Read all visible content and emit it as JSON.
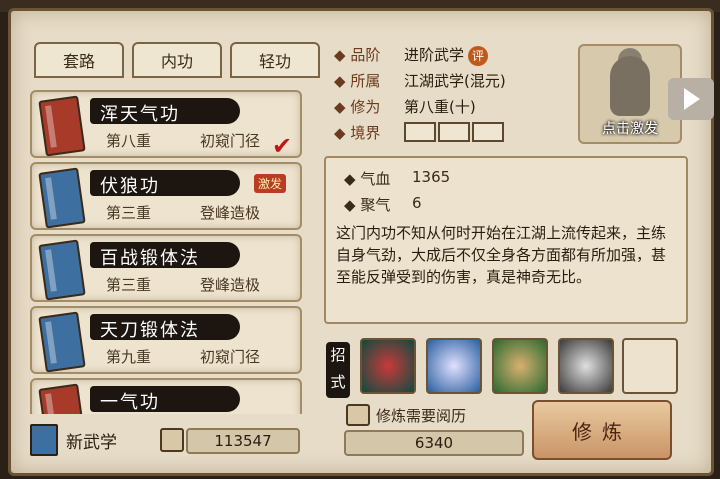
{
  "tabs": [
    "套路",
    "内功",
    "轻功"
  ],
  "skills": [
    {
      "name": "浑天气功",
      "level": "第八重",
      "stage": "初窥门径",
      "book": "red",
      "badge": "",
      "checked": true
    },
    {
      "name": "伏狼功",
      "level": "第三重",
      "stage": "登峰造极",
      "book": "blue",
      "badge": "激发",
      "checked": false
    },
    {
      "name": "百战锻体法",
      "level": "第三重",
      "stage": "登峰造极",
      "book": "blue",
      "badge": "",
      "checked": false
    },
    {
      "name": "天刀锻体法",
      "level": "第九重",
      "stage": "初窥门径",
      "book": "blue",
      "badge": "",
      "checked": false
    },
    {
      "name": "一气功",
      "level": "",
      "stage": "",
      "book": "red",
      "badge": "",
      "checked": false
    }
  ],
  "attributes": {
    "grade_label": "品阶",
    "grade_value": "进阶武学",
    "grade_badge": "评",
    "school_label": "所属",
    "school_value": "江湖武学(混元)",
    "cultivation_label": "修为",
    "cultivation_value": "第八重(十)",
    "realm_label": "境界"
  },
  "avatar": {
    "label": "点击激发"
  },
  "stats": {
    "hp_label": "气血",
    "hp_value": "1365",
    "qi_label": "聚气",
    "qi_value": "6"
  },
  "description": "这门内功不知从何时开始在江湖上流传起来，主练自身气劲，大成后不仅全身各方面都有所加强，甚至能反弹受到的伤害，真是神奇无比。",
  "moves_label": "招式",
  "footer": {
    "new_skill_label": "新武学",
    "experience_value": "113547",
    "need_label": "修炼需要阅历",
    "need_value": "6340",
    "train_button": "修炼"
  },
  "colors": {
    "accent": "#b93d22",
    "check": "#c01818"
  }
}
